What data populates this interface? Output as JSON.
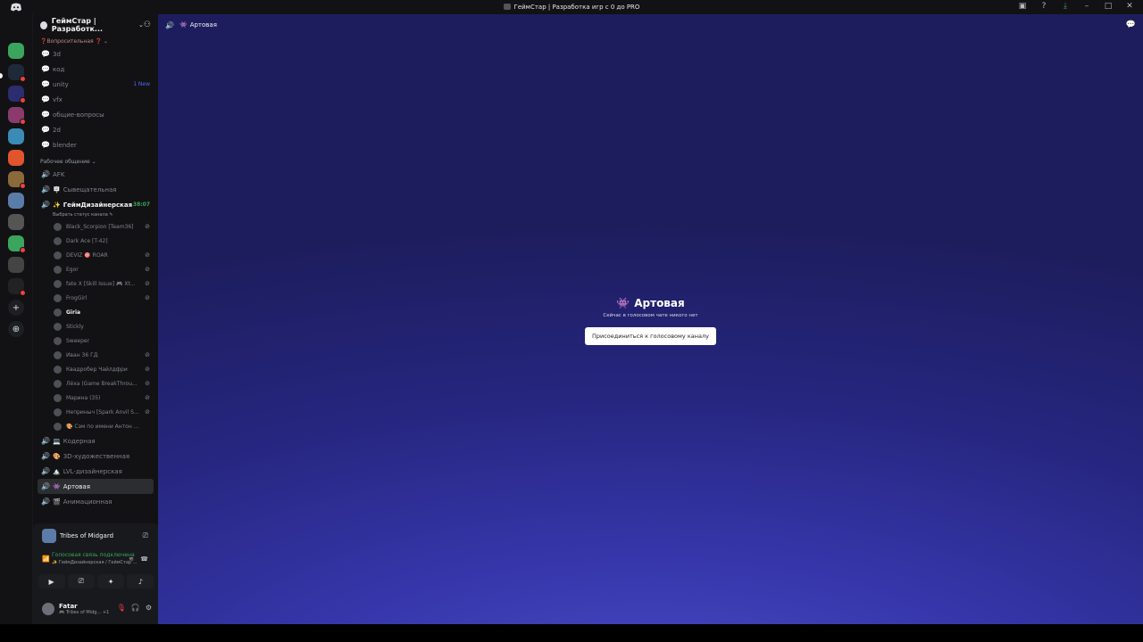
{
  "window": {
    "title": "ГеймСтар | Разработка игр с 0 до PRO"
  },
  "guild": {
    "name": "ГеймСтар | Разработк..."
  },
  "categories": {
    "questions": "❓Вопросительная ❓ ⌄",
    "work": "Рабочее общение ⌄"
  },
  "text_channels": [
    {
      "name": "3d"
    },
    {
      "name": "код"
    },
    {
      "name": "unity",
      "badge": "1 New"
    },
    {
      "name": "vfx"
    },
    {
      "name": "общие-вопросы"
    },
    {
      "name": "2d"
    },
    {
      "name": "blender"
    }
  ],
  "voice_channels_top": [
    {
      "name": "AFK",
      "emoji": ""
    },
    {
      "name": "Сывещательная",
      "emoji": "🪧"
    }
  ],
  "active_voice": {
    "name": "ГеймДизайнерская",
    "emoji": "✨",
    "timer": "38:07",
    "status": "Выбрать статус канала ✎"
  },
  "voice_users": [
    {
      "name": "Black_Scorpion [Team36]",
      "muted": true
    },
    {
      "name": "Dark Ace [T-42]",
      "muted": false
    },
    {
      "name": "DEVIZ 🎯 ROAR",
      "muted": true
    },
    {
      "name": "Egor",
      "muted": true
    },
    {
      "name": "fate X [Skill Issue] 🎮 Xt...",
      "muted": true
    },
    {
      "name": "FrogGirl",
      "muted": true
    },
    {
      "name": "Giria",
      "muted": false,
      "me": true
    },
    {
      "name": "Stickly",
      "muted": false
    },
    {
      "name": "Sweeper",
      "muted": false
    },
    {
      "name": "Иван 36 ГД",
      "muted": true
    },
    {
      "name": "Квадробер Чайлдфри",
      "muted": true
    },
    {
      "name": "Лёха (Game BreakThrou...",
      "muted": true
    },
    {
      "name": "Марина (35)",
      "muted": true
    },
    {
      "name": "Неприныч [Spark Anvil S...",
      "muted": true
    },
    {
      "name": "🎨 Сэм по имени Антон ...",
      "muted": false
    }
  ],
  "voice_channels_bottom": [
    {
      "name": "Кодерная",
      "emoji": "💻"
    },
    {
      "name": "3D-художественная",
      "emoji": "🎨"
    },
    {
      "name": "LVL-дизайнерская",
      "emoji": "🏔️"
    },
    {
      "name": "Артовая",
      "emoji": "👾",
      "selected": true
    },
    {
      "name": "Анимационная",
      "emoji": "🎬"
    }
  ],
  "panel": {
    "game": "Tribes of Midgard",
    "voice_title": "Голосовая связь подключена",
    "voice_sub": "✨ ГеймДизайнерская / ГеймСтар ...",
    "user_name": "Fatar",
    "user_status": "🎮 Tribes of Midg... +1"
  },
  "main": {
    "channel_name": "Артовая",
    "channel_emoji": "👾",
    "empty_text": "Сейчас в голосовом чате никого нет",
    "join_label": "Присоединиться к голосовому каналу"
  },
  "colors": {
    "accent": "#5865f2",
    "online": "#3ba55d",
    "danger": "#f23f43"
  }
}
